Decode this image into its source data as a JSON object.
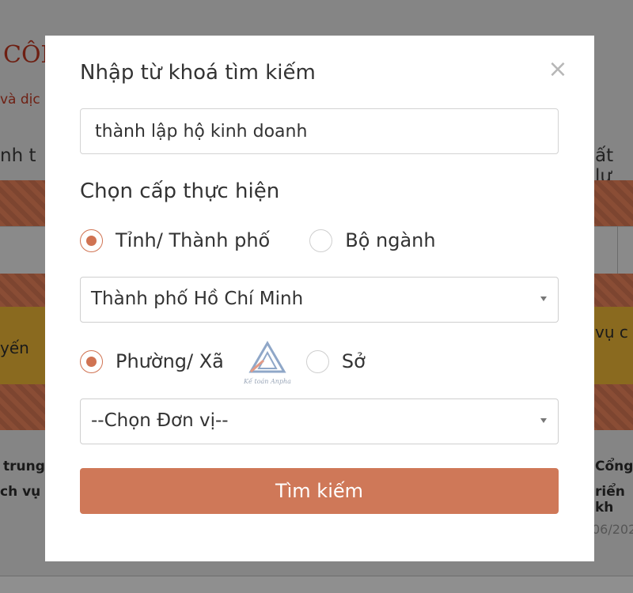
{
  "background": {
    "title_fragment": "CÔN",
    "subtitle_fragment": "và dịc",
    "left_heading_fragment": "nh t",
    "right_heading_fragment": "ất lư",
    "banner_left_fragment": "yến",
    "banner_right_fragment": "vụ c",
    "card_left_line1": "trung",
    "card_left_line2": "ch vụ c",
    "card_right_line1": "Cổng",
    "card_right_line2": "riển kh",
    "card_right_date": "06/202"
  },
  "modal": {
    "title": "Nhập từ khoá tìm kiếm",
    "close_label": "×",
    "keyword_value": "thành lập hộ kinh doanh",
    "level_label": "Chọn cấp thực hiện",
    "level_options": [
      {
        "label": "Tỉnh/ Thành phố",
        "checked": true
      },
      {
        "label": "Bộ ngành",
        "checked": false
      }
    ],
    "province_select": "Thành phố Hồ Chí Minh",
    "unit_options": [
      {
        "label": "Phường/ Xã",
        "checked": true
      },
      {
        "label": "Sở",
        "checked": false
      }
    ],
    "unit_select": "--Chọn Đơn vị--",
    "search_button": "Tìm kiếm",
    "watermark_text": "Kế toán Anpha"
  },
  "colors": {
    "accent": "#cf7858",
    "radio_checked": "#d07352",
    "overlay": "#858585"
  },
  "icons": {
    "close": "close-icon",
    "dropdown": "chevron-down-icon",
    "watermark": "logo-watermark"
  }
}
